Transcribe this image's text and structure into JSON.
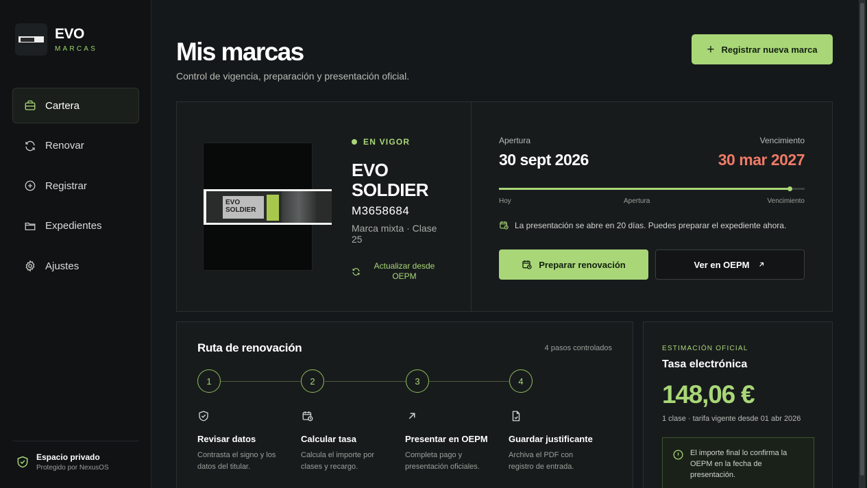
{
  "brand": {
    "title": "EVO",
    "subtitle": "MARCAS"
  },
  "nav": [
    {
      "label": "Cartera",
      "icon": "briefcase-icon",
      "active": true
    },
    {
      "label": "Renovar",
      "icon": "refresh-icon"
    },
    {
      "label": "Registrar",
      "icon": "plus-circle-icon"
    },
    {
      "label": "Expedientes",
      "icon": "folder-icon"
    },
    {
      "label": "Ajustes",
      "icon": "gear-icon"
    }
  ],
  "footer": {
    "title": "Espacio privado",
    "subtitle": "Protegido por NexusOS"
  },
  "page": {
    "title": "Mis marcas",
    "subtitle": "Control de vigencia, preparación y presentación oficial.",
    "new_button": "Registrar nueva marca"
  },
  "mark": {
    "status": "EN VIGOR",
    "name": "EVO SOLDIER",
    "number": "M3658684",
    "type": "Marca mixta · Clase 25",
    "update_label": "Actualizar desde OEPM"
  },
  "timeline": {
    "opening_label": "Apertura",
    "opening_date": "30 sept 2026",
    "expiry_label": "Vencimiento",
    "expiry_date": "30 mar 2027",
    "today": "Hoy",
    "mid": "Apertura",
    "end": "Vencimiento",
    "progress": 0.95,
    "note": "La presentación se abre en 20 días. Puedes preparar el expediente ahora.",
    "prepare_button": "Preparar renovación",
    "oepm_button": "Ver en OEPM"
  },
  "route": {
    "title": "Ruta de renovación",
    "meta": "4 pasos controlados",
    "steps": [
      {
        "number": "1",
        "title": "Revisar datos",
        "desc": "Contrasta el signo y los datos del titular.",
        "icon": "shield-check-icon"
      },
      {
        "number": "2",
        "title": "Calcular tasa",
        "desc": "Calcula el importe por clases y recargo.",
        "icon": "calendar-clock-icon"
      },
      {
        "number": "3",
        "title": "Presentar en OEPM",
        "desc": "Completa pago y presentación oficiales.",
        "icon": "arrow-up-right-icon"
      },
      {
        "number": "4",
        "title": "Guardar justificante",
        "desc": "Archiva el PDF con registro de entrada.",
        "icon": "document-check-icon"
      }
    ]
  },
  "fee": {
    "kicker": "ESTIMACIÓN OFICIAL",
    "title": "Tasa electrónica",
    "value": "148,06 €",
    "sub": "1 clase · tarifa vigente desde 01 abr 2026",
    "note": "El importe final lo confirma la OEPM en la fecha de presentación."
  },
  "colors": {
    "accent": "#a9d778",
    "danger": "#ef7b67",
    "background": "#15181a"
  }
}
